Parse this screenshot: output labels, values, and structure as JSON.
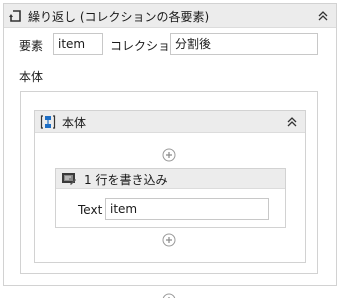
{
  "foreach": {
    "title": "繰り返し (コレクションの各要素)",
    "element_label": "要素",
    "element_value": "item",
    "collection_label": "コレクション",
    "collection_value": "分割後",
    "body_label": "本体"
  },
  "sequence": {
    "title": "本体"
  },
  "write_line": {
    "title": "1 行を書き込み",
    "text_label": "Text",
    "text_value": "item"
  },
  "icons": {
    "foreach": "foreach-loop-icon",
    "sequence": "sequence-icon",
    "write_line": "write-line-icon",
    "collapse": "double-chevron-up-icon",
    "add": "add-circle-icon"
  },
  "colors": {
    "header_bg": "#ececec",
    "border": "#d2d2d2",
    "sequence_icon_blue": "#1f6fc5"
  }
}
